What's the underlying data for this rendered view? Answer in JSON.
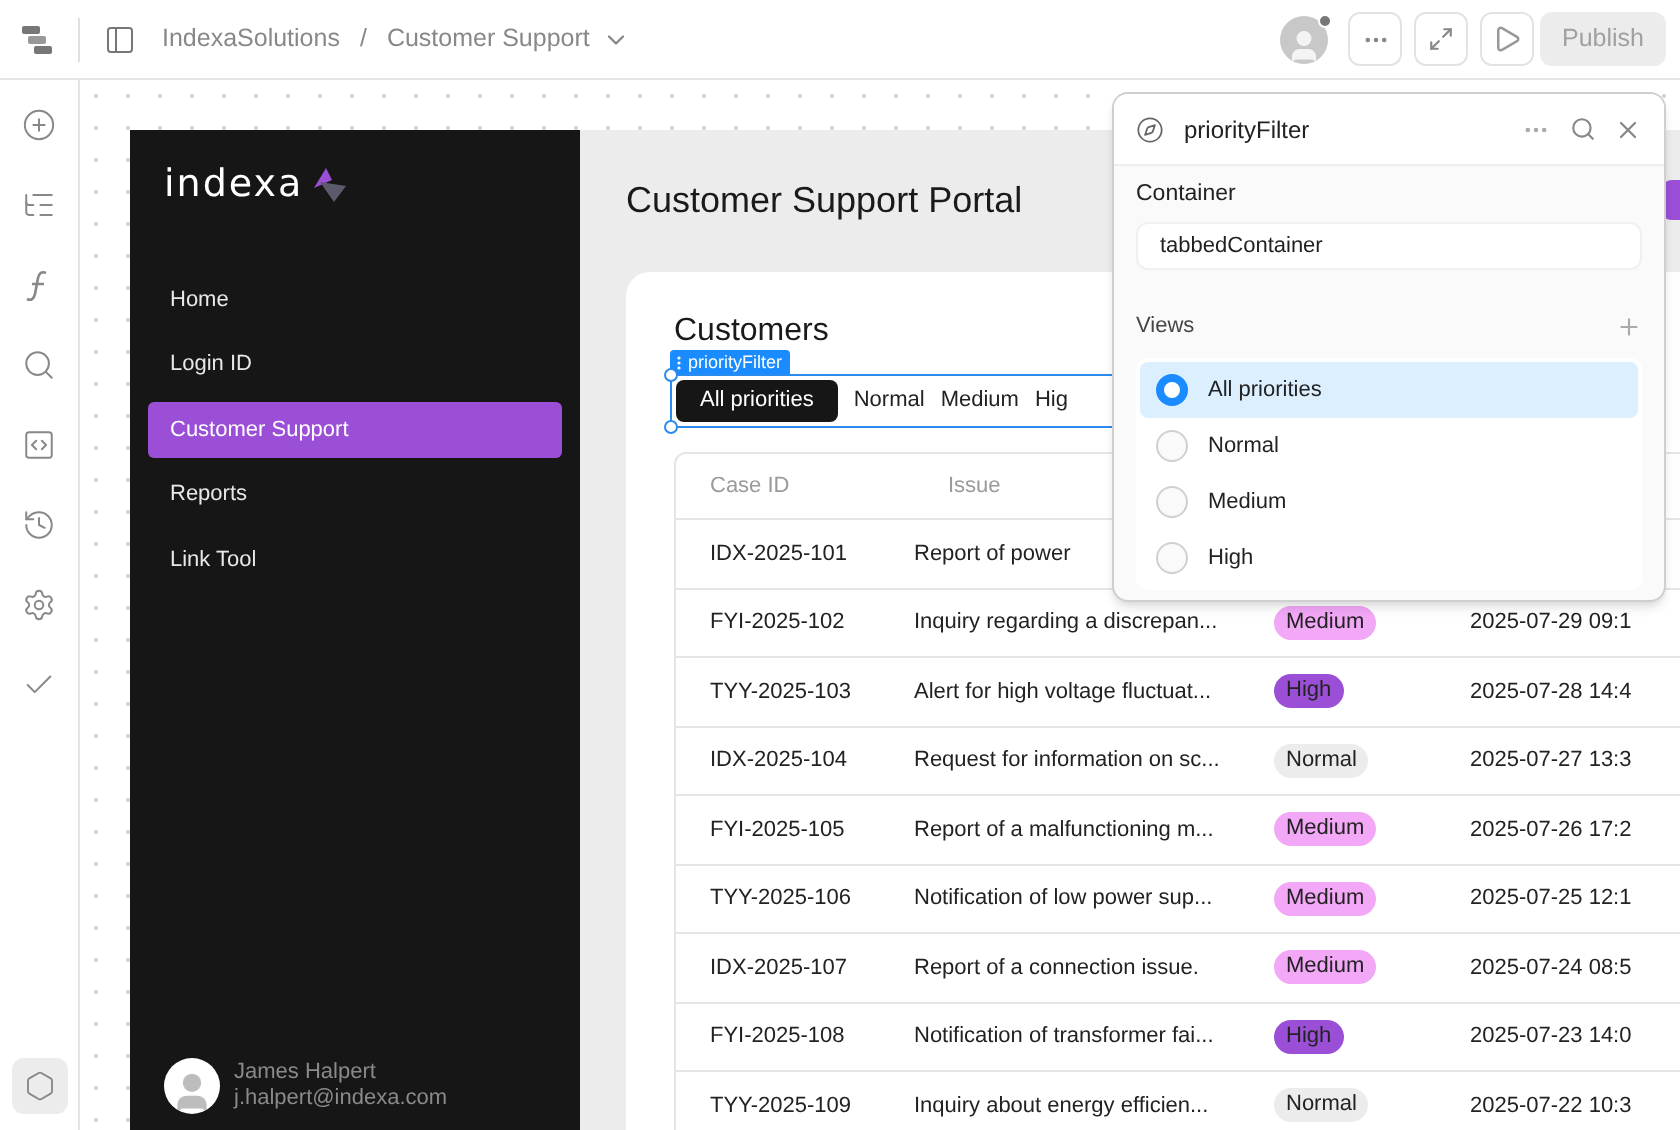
{
  "topbar": {
    "crumbs": [
      {
        "kind": "text",
        "label": "IndexaSolutions"
      },
      {
        "kind": "separator",
        "label": "/"
      },
      {
        "kind": "menu",
        "label": "Customer Support"
      }
    ],
    "publish": {
      "label": "Publish",
      "disabled": true
    }
  },
  "app": {
    "logo": "indexa",
    "nav": [
      {
        "label": "Home",
        "selected": false
      },
      {
        "label": "Login ID",
        "selected": false
      },
      {
        "label": "Customer Support",
        "selected": true
      },
      {
        "label": "Reports",
        "selected": false
      },
      {
        "label": "Link Tool",
        "selected": false
      }
    ],
    "user": {
      "name": "James Halpert",
      "email": "j.halpert@indexa.com"
    },
    "title": "Customer Support Portal",
    "card_title": "Customers",
    "component_label": "priorityFilter",
    "tabs": [
      {
        "label": "All priorities",
        "selected": true
      },
      {
        "label": "Normal",
        "selected": false
      },
      {
        "label": "Medium",
        "selected": false
      },
      {
        "label": "Hig",
        "selected": false
      }
    ],
    "table": {
      "columns": [
        "Case ID",
        "Issue"
      ],
      "rows": [
        {
          "case_id": "IDX-2025-101",
          "issue": "Report of power"
        },
        {
          "case_id": "FYI-2025-102",
          "issue": "Inquiry regarding a discrepan...",
          "priority": {
            "label": "Medium",
            "color": "#f2a7f7"
          },
          "date": "2025-07-29 09:1"
        },
        {
          "case_id": "TYY-2025-103",
          "issue": "Alert for high voltage fluctuat...",
          "priority": {
            "label": "High",
            "color": "#9b4fd6"
          },
          "date": "2025-07-28 14:4"
        },
        {
          "case_id": "IDX-2025-104",
          "issue": "Request for information on sc...",
          "priority": {
            "label": "Normal",
            "color": "#ececec"
          },
          "date": "2025-07-27 13:3"
        },
        {
          "case_id": "FYI-2025-105",
          "issue": "Report of a malfunctioning m...",
          "priority": {
            "label": "Medium",
            "color": "#f2a7f7"
          },
          "date": "2025-07-26 17:2"
        },
        {
          "case_id": "TYY-2025-106",
          "issue": "Notification of low power sup...",
          "priority": {
            "label": "Medium",
            "color": "#f2a7f7"
          },
          "date": "2025-07-25 12:1"
        },
        {
          "case_id": "IDX-2025-107",
          "issue": "Report of a connection issue.",
          "priority": {
            "label": "Medium",
            "color": "#f2a7f7"
          },
          "date": "2025-07-24 08:5"
        },
        {
          "case_id": "FYI-2025-108",
          "issue": "Notification of transformer fai...",
          "priority": {
            "label": "High",
            "color": "#9b4fd6"
          },
          "date": "2025-07-23 14:0"
        },
        {
          "case_id": "TYY-2025-109",
          "issue": "Inquiry about energy efficien...",
          "priority": {
            "label": "Normal",
            "color": "#ececec"
          },
          "date": "2025-07-22 10:3"
        }
      ]
    }
  },
  "panel": {
    "title": "priorityFilter",
    "container_label": "Container",
    "container_value": "tabbedContainer",
    "views_label": "Views",
    "views": [
      {
        "label": "All priorities",
        "selected": true
      },
      {
        "label": "Normal",
        "selected": false
      },
      {
        "label": "Medium",
        "selected": false
      },
      {
        "label": "High",
        "selected": false
      }
    ]
  }
}
